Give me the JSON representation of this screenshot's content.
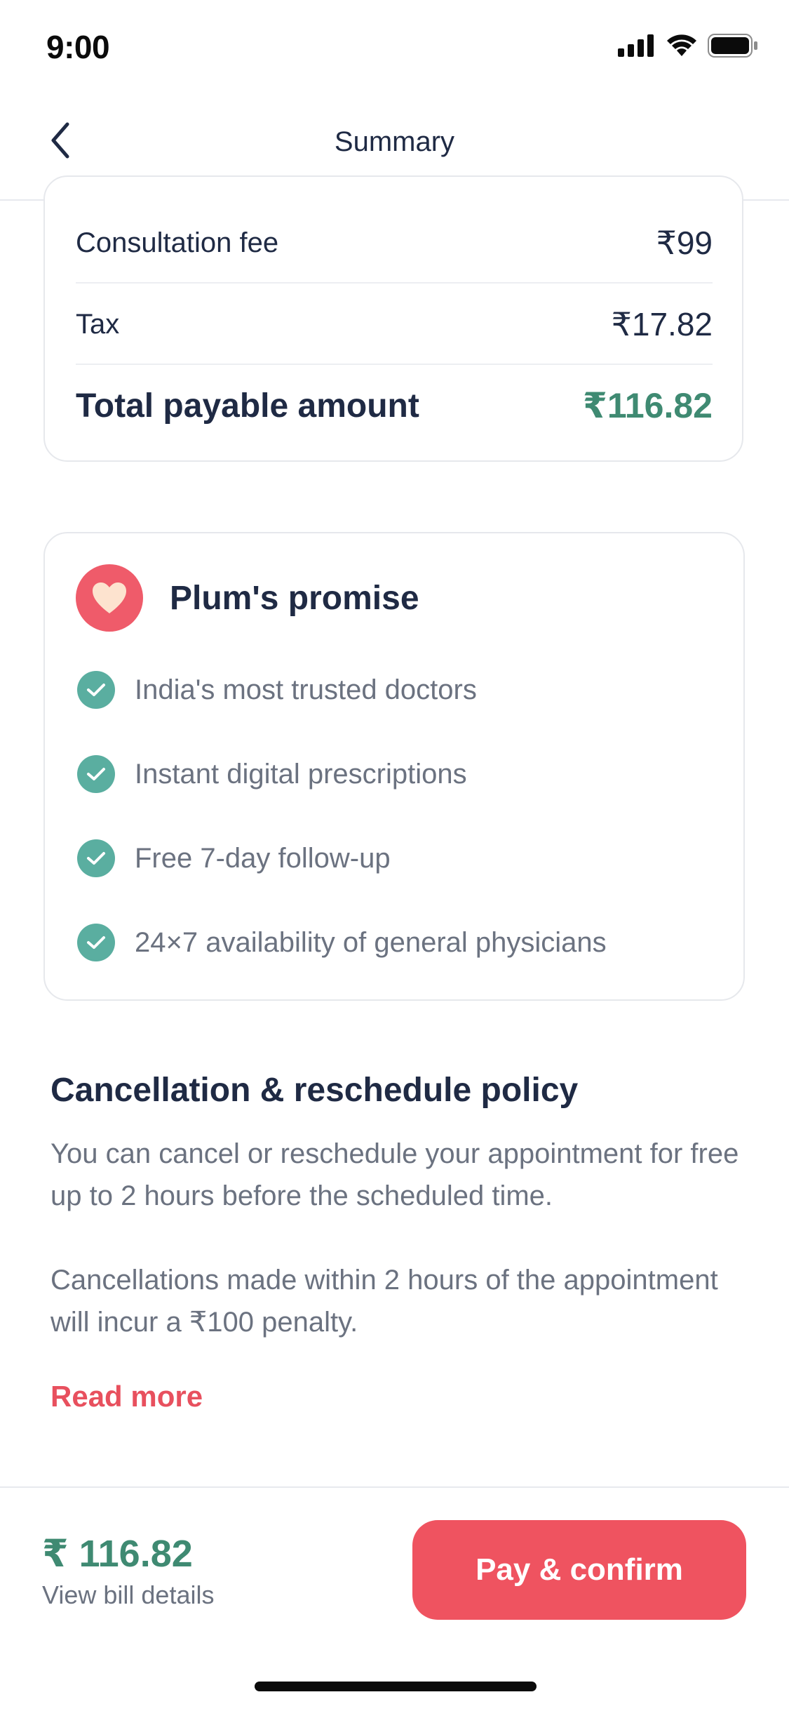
{
  "status_bar": {
    "time": "9:00"
  },
  "header": {
    "title": "Summary"
  },
  "bill": {
    "rows": [
      {
        "label": "Consultation fee",
        "value": "₹99"
      },
      {
        "label": "Tax",
        "value": "₹17.82"
      }
    ],
    "total": {
      "label": "Total payable amount",
      "value": "₹116.82"
    }
  },
  "promise": {
    "title": "Plum's promise",
    "items": [
      "India's most trusted doctors",
      "Instant digital prescriptions",
      "Free 7-day follow-up",
      "24×7 availability of general physicians"
    ]
  },
  "policy": {
    "title": "Cancellation & reschedule policy",
    "paragraph_1": "You can cancel or reschedule your appointment for free up to 2 hours before the scheduled time.",
    "paragraph_2": "Cancellations made within 2 hours of the appointment will incur a ₹100 penalty.",
    "read_more": "Read more"
  },
  "footer": {
    "amount": "₹ 116.82",
    "bill_details_link": "View bill details",
    "pay_button": "Pay & confirm"
  },
  "colors": {
    "accent_red": "#ef5360",
    "amount_green": "#3f8a72",
    "check_teal": "#5aaea0",
    "heading_navy": "#1f2a44",
    "muted_gray": "#6b7280"
  }
}
